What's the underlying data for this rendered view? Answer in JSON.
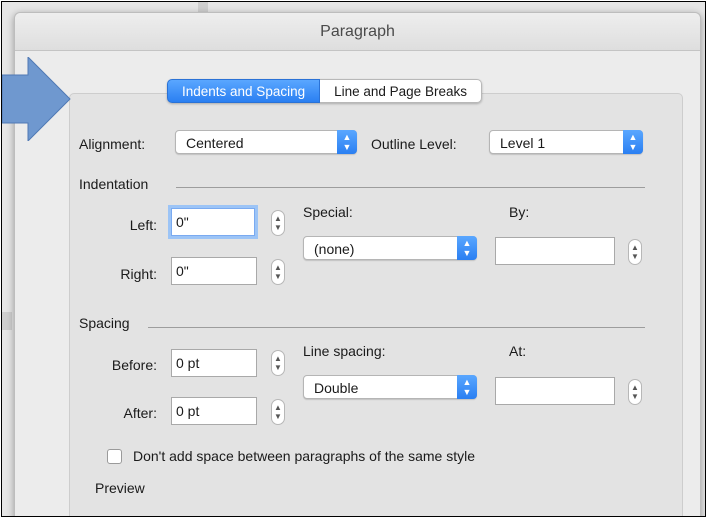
{
  "dialog": {
    "title": "Paragraph"
  },
  "tabs": [
    {
      "label": "Indents and Spacing",
      "active": true
    },
    {
      "label": "Line and Page Breaks",
      "active": false
    }
  ],
  "alignment": {
    "label": "Alignment:",
    "value": "Centered"
  },
  "outline_level": {
    "label": "Outline Level:",
    "value": "Level 1"
  },
  "indentation": {
    "section_label": "Indentation",
    "left_label": "Left:",
    "left_value": "0\"",
    "right_label": "Right:",
    "right_value": "0\"",
    "special_label": "Special:",
    "special_value": "(none)",
    "by_label": "By:",
    "by_value": ""
  },
  "spacing": {
    "section_label": "Spacing",
    "before_label": "Before:",
    "before_value": "0 pt",
    "after_label": "After:",
    "after_value": "0 pt",
    "line_spacing_label": "Line spacing:",
    "line_spacing_value": "Double",
    "at_label": "At:",
    "at_value": ""
  },
  "options": {
    "dont_add_space_label": "Don't add space between paragraphs of the same style",
    "dont_add_space_checked": false
  },
  "preview": {
    "label": "Preview"
  },
  "colors": {
    "accent": "#2a7ff2",
    "arrow": "#6f98cf"
  }
}
